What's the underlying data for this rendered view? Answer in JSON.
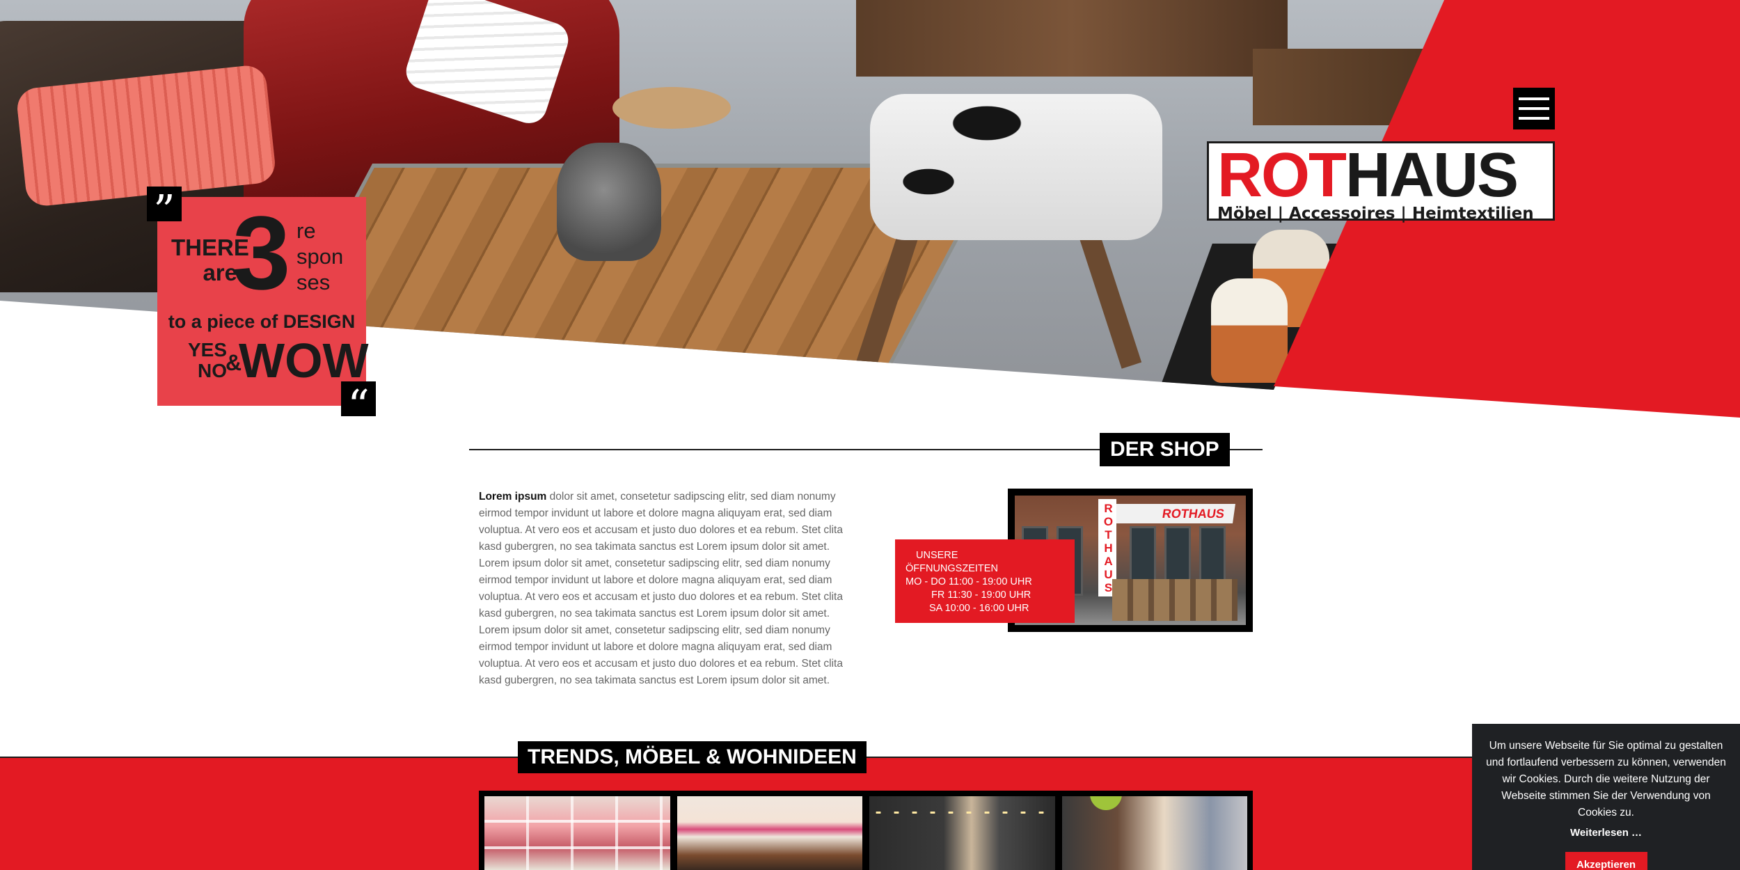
{
  "brand": {
    "logo_part1": "ROT",
    "logo_part2": "HAUS",
    "tagline": "Möbel | Accessoires | Heimtextilien",
    "accent_color": "#e31a23"
  },
  "header": {
    "menu_icon": "hamburger-icon"
  },
  "quote": {
    "open_mark": "”",
    "close_mark": "“",
    "line_there": "THERE",
    "line_are": "are",
    "big_number": "3",
    "resp_1": "re",
    "resp_2": "spon",
    "resp_3": "ses",
    "design_line": "to a piece of DESIGN",
    "yes": "YES",
    "no": "NO",
    "amp": "&",
    "wow": "WOW"
  },
  "shop_section": {
    "title": "DER SHOP",
    "intro_bold": "Lorem ipsum",
    "paragraph_1": " dolor sit amet, consetetur sadipscing elitr, sed diam nonumy eirmod tempor invidunt ut labore et dolore magna aliquyam erat, sed diam voluptua. At vero eos et accusam et justo duo dolores et ea rebum. Stet clita kasd gubergren, no sea takimata sanctus est Lorem ipsum dolor sit amet. Lorem ipsum dolor sit amet, consetetur sadipscing elitr, sed diam nonumy eirmod tempor invidunt ut labore et dolore magna aliquyam erat, sed diam voluptua. At vero eos et accusam et justo duo dolores et ea rebum. Stet clita kasd gubergren, no sea takimata sanctus est Lorem ipsum dolor sit amet.",
    "paragraph_2": "Lorem ipsum dolor sit amet, consetetur sadipscing elitr, sed diam nonumy eirmod tempor invidunt ut labore et dolore magna aliquyam erat, sed diam voluptua. At vero eos et accusam et justo duo dolores et ea rebum. Stet clita kasd gubergren, no sea takimata sanctus est Lorem ipsum dolor sit amet.",
    "storefront_sign": "ROTHAUS",
    "storefront_vsign": "ROTHAUS",
    "opening_title_1": "UNSERE",
    "opening_title_2": "ÖFFNUNGSZEITEN",
    "hours": [
      "MO - DO 11:00 - 19:00 UHR",
      "FR 11:30 - 19:00 UHR",
      "SA 10:00 - 16:00 UHR"
    ]
  },
  "trends_section": {
    "title": "TRENDS, MÖBEL & WOHNIDEEN"
  },
  "cookie": {
    "text": "Um unsere Webseite für Sie optimal zu gestalten und fortlaufend verbessern zu können, verwenden wir Cookies. Durch die weitere Nutzung der Webseite stimmen Sie der Verwendung von Cookies zu.",
    "more_link": "Weiterlesen …",
    "accept_button": "Akzeptieren"
  }
}
